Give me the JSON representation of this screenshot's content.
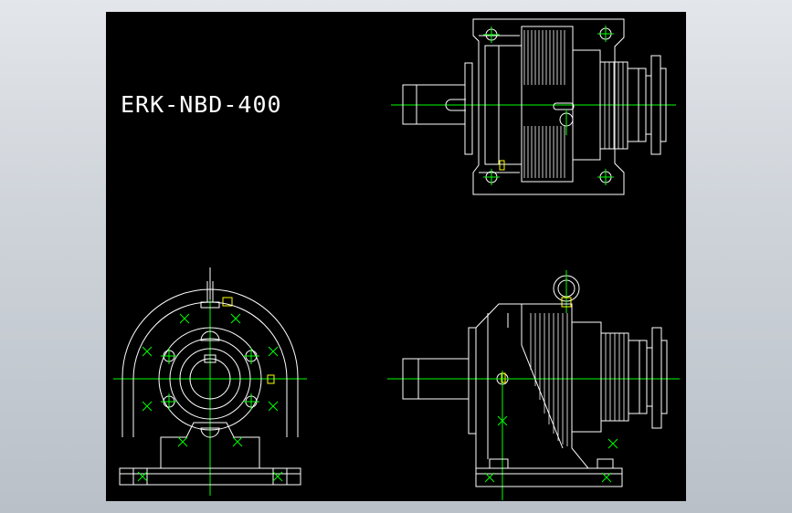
{
  "drawing": {
    "title": "ERK-NBD-400",
    "background_color": "#000000",
    "line_color": "#ffffff",
    "centerline_color": "#00ff00",
    "accent_color": "#ffff00"
  },
  "views": [
    {
      "name": "top-view"
    },
    {
      "name": "end-view"
    },
    {
      "name": "side-view"
    }
  ]
}
